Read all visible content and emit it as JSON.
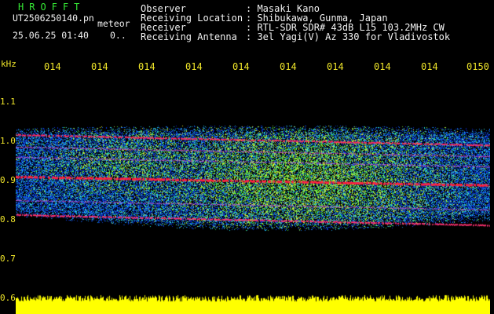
{
  "header": {
    "app_title": "HROFFT",
    "filename": "UT2506250140.pn",
    "meteor_label": "meteor",
    "datetime": "25.06.25 01:40",
    "count": "0.."
  },
  "info": [
    {
      "label": "Observer",
      "value": ": Masaki Kano"
    },
    {
      "label": "Receiving Location",
      "value": ": Shibukawa, Gunma, Japan"
    },
    {
      "label": "Receiver",
      "value": ": RTL-SDR SDR# 43dB L15 103.2MHz CW"
    },
    {
      "label": "Receiving Antenna",
      "value": ": 3el Yagi(V) Az 330 for Vladivostok"
    }
  ],
  "axis": {
    "unit": "kHz",
    "time_ticks": [
      "014",
      "014",
      "014",
      "014",
      "014",
      "014",
      "014",
      "014",
      "014",
      "0150"
    ],
    "freq_ticks": [
      "1.1",
      "1.0",
      "0.9",
      "0.8",
      "0.7",
      "0.6"
    ]
  },
  "colors": {
    "background": "#000000",
    "title_green": "#35e835",
    "text_white": "#f2f2f2",
    "tick_yellow": "#f0e62a",
    "noise_floor_yellow": "#ffff00",
    "signal_red": "#ff2040",
    "signal_green": "#40e060",
    "noise_blue": "#1030c0"
  }
}
